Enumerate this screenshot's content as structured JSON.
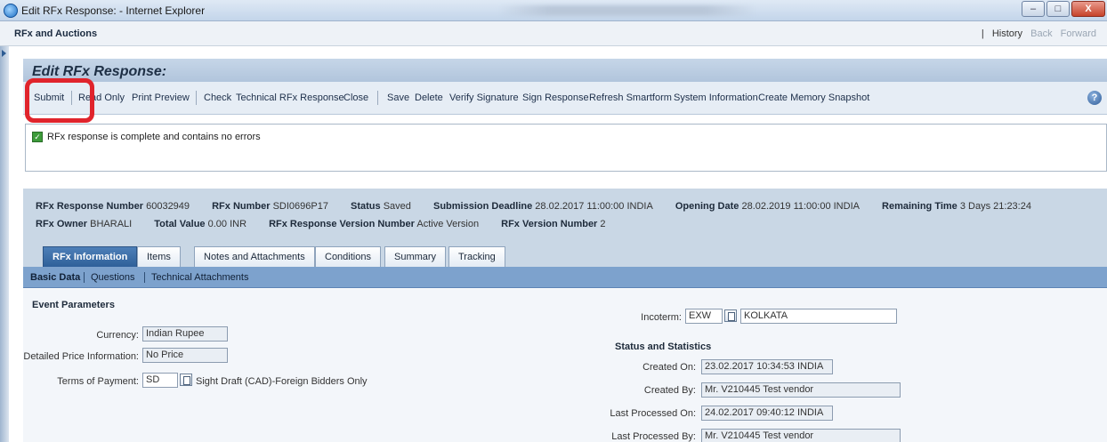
{
  "window": {
    "title": "Edit RFx Response: - Internet Explorer",
    "min": "–",
    "max": "□",
    "close": "X"
  },
  "app": {
    "title": "RFx and Auctions",
    "nav": {
      "divider": "|",
      "history": "History",
      "back": "Back",
      "forward": "Forward"
    }
  },
  "page": {
    "title": "Edit RFx Response:"
  },
  "toolbar": {
    "items": [
      "Submit",
      "Read Only",
      "Print Preview",
      "Check",
      "Technical RFx Response",
      "Close",
      "Save",
      "Delete",
      "Verify Signature",
      "Sign Response",
      "Refresh Smartform",
      "System Information",
      "Create Memory Snapshot"
    ],
    "help": "?"
  },
  "message": {
    "text": "RFx response is complete and contains no errors"
  },
  "header_info": {
    "response_number_label": "RFx Response Number",
    "response_number": "60032949",
    "rfx_number_label": "RFx Number",
    "rfx_number": "SDI0696P17",
    "status_label": "Status",
    "status": "Saved",
    "deadline_label": "Submission Deadline",
    "deadline": "28.02.2017 11:00:00 INDIA",
    "opening_label": "Opening Date",
    "opening": "28.02.2019 11:00:00 INDIA",
    "remaining_label": "Remaining Time",
    "remaining": "3 Days 21:23:24",
    "owner_label": "RFx Owner",
    "owner": "BHARALI",
    "total_label": "Total Value",
    "total": "0.00 INR",
    "version_label": "RFx Response Version Number",
    "version": "Active Version",
    "rfx_version_label": "RFx Version Number",
    "rfx_version": "2"
  },
  "tabs": [
    "RFx Information",
    "Items",
    "Notes and Attachments",
    "Conditions",
    "Summary",
    "Tracking"
  ],
  "subtabs": [
    "Basic Data",
    "Questions",
    "Technical Attachments"
  ],
  "event": {
    "heading": "Event Parameters",
    "currency_label": "Currency:",
    "currency": "Indian Rupee",
    "price_label": "Detailed Price Information:",
    "price": "No Price",
    "terms_label": "Terms of Payment:",
    "terms_code": "SD",
    "terms_text": "Sight Draft (CAD)-Foreign Bidders Only"
  },
  "incoterm": {
    "label": "Incoterm:",
    "code": "EXW",
    "location": "KOLKATA"
  },
  "status_stats": {
    "heading": "Status and Statistics",
    "created_on_label": "Created On:",
    "created_on": "23.02.2017 10:34:53 INDIA",
    "created_by_label": "Created By:",
    "created_by": "Mr. V210445 Test vendor",
    "last_on_label": "Last Processed On:",
    "last_on": "24.02.2017 09:40:12 INDIA",
    "last_by_label": "Last Processed By:",
    "last_by": "Mr. V210445 Test vendor"
  },
  "colors": {
    "highlight": "#e0242c",
    "active_tab": "#2f6099"
  }
}
